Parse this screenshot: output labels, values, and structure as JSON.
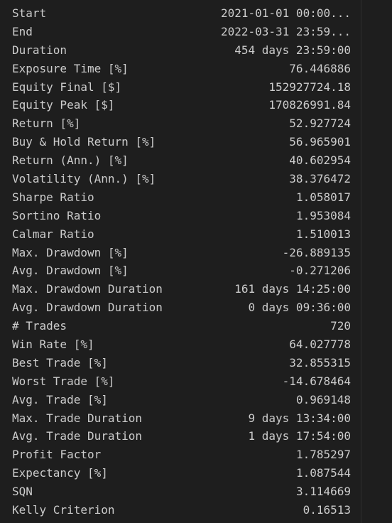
{
  "stats": {
    "rows": [
      {
        "label": "Start",
        "value": "2021-01-01 00:00..."
      },
      {
        "label": "End",
        "value": "2022-03-31 23:59..."
      },
      {
        "label": "Duration",
        "value": "454 days 23:59:00"
      },
      {
        "label": "Exposure Time [%]",
        "value": "76.446886"
      },
      {
        "label": "Equity Final [$]",
        "value": "152927724.18"
      },
      {
        "label": "Equity Peak [$]",
        "value": "170826991.84"
      },
      {
        "label": "Return [%]",
        "value": "52.927724"
      },
      {
        "label": "Buy & Hold Return [%]",
        "value": "56.965901"
      },
      {
        "label": "Return (Ann.) [%]",
        "value": "40.602954"
      },
      {
        "label": "Volatility (Ann.) [%]",
        "value": "38.376472"
      },
      {
        "label": "Sharpe Ratio",
        "value": "1.058017"
      },
      {
        "label": "Sortino Ratio",
        "value": "1.953084"
      },
      {
        "label": "Calmar Ratio",
        "value": "1.510013"
      },
      {
        "label": "Max. Drawdown [%]",
        "value": "-26.889135"
      },
      {
        "label": "Avg. Drawdown [%]",
        "value": "-0.271206"
      },
      {
        "label": "Max. Drawdown Duration",
        "value": "161 days 14:25:00"
      },
      {
        "label": "Avg. Drawdown Duration",
        "value": "0 days 09:36:00"
      },
      {
        "label": "# Trades",
        "value": "720"
      },
      {
        "label": "Win Rate [%]",
        "value": "64.027778"
      },
      {
        "label": "Best Trade [%]",
        "value": "32.855315"
      },
      {
        "label": "Worst Trade [%]",
        "value": "-14.678464"
      },
      {
        "label": "Avg. Trade [%]",
        "value": "0.969148"
      },
      {
        "label": "Max. Trade Duration",
        "value": "9 days 13:34:00"
      },
      {
        "label": "Avg. Trade Duration",
        "value": "1 days 17:54:00"
      },
      {
        "label": "Profit Factor",
        "value": "1.785297"
      },
      {
        "label": "Expectancy [%]",
        "value": "1.087544"
      },
      {
        "label": "SQN",
        "value": "3.114669"
      },
      {
        "label": "Kelly Criterion",
        "value": "0.16513"
      }
    ]
  },
  "colors": {
    "background": "#1e1e1e",
    "text": "#cccccc"
  }
}
